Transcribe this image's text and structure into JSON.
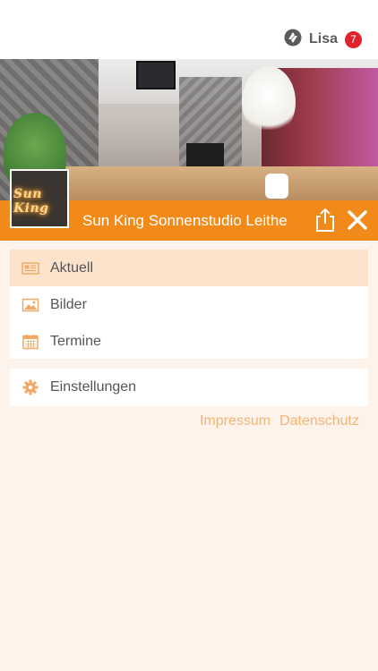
{
  "header": {
    "user_name": "Lisa",
    "notification_count": "7",
    "user_icon": "logo-mark-icon"
  },
  "hero": {
    "logo_text": "Sun King"
  },
  "title_bar": {
    "title": "Sun King Sonnenstudio Leithe",
    "share_icon": "share-icon",
    "close_icon": "close-icon"
  },
  "menu": {
    "items": [
      {
        "label": "Aktuell",
        "icon": "newspaper-icon",
        "active": true
      },
      {
        "label": "Bilder",
        "icon": "image-icon",
        "active": false
      },
      {
        "label": "Termine",
        "icon": "calendar-icon",
        "active": false
      }
    ],
    "settings": {
      "label": "Einstellungen",
      "icon": "gear-icon"
    }
  },
  "footer": {
    "impressum": "Impressum",
    "datenschutz": "Datenschutz"
  },
  "colors": {
    "accent": "#f28a1a",
    "active_row": "#fde3cc",
    "background": "#fdf3ea",
    "badge": "#e0222b",
    "link": "#f2b57a"
  }
}
